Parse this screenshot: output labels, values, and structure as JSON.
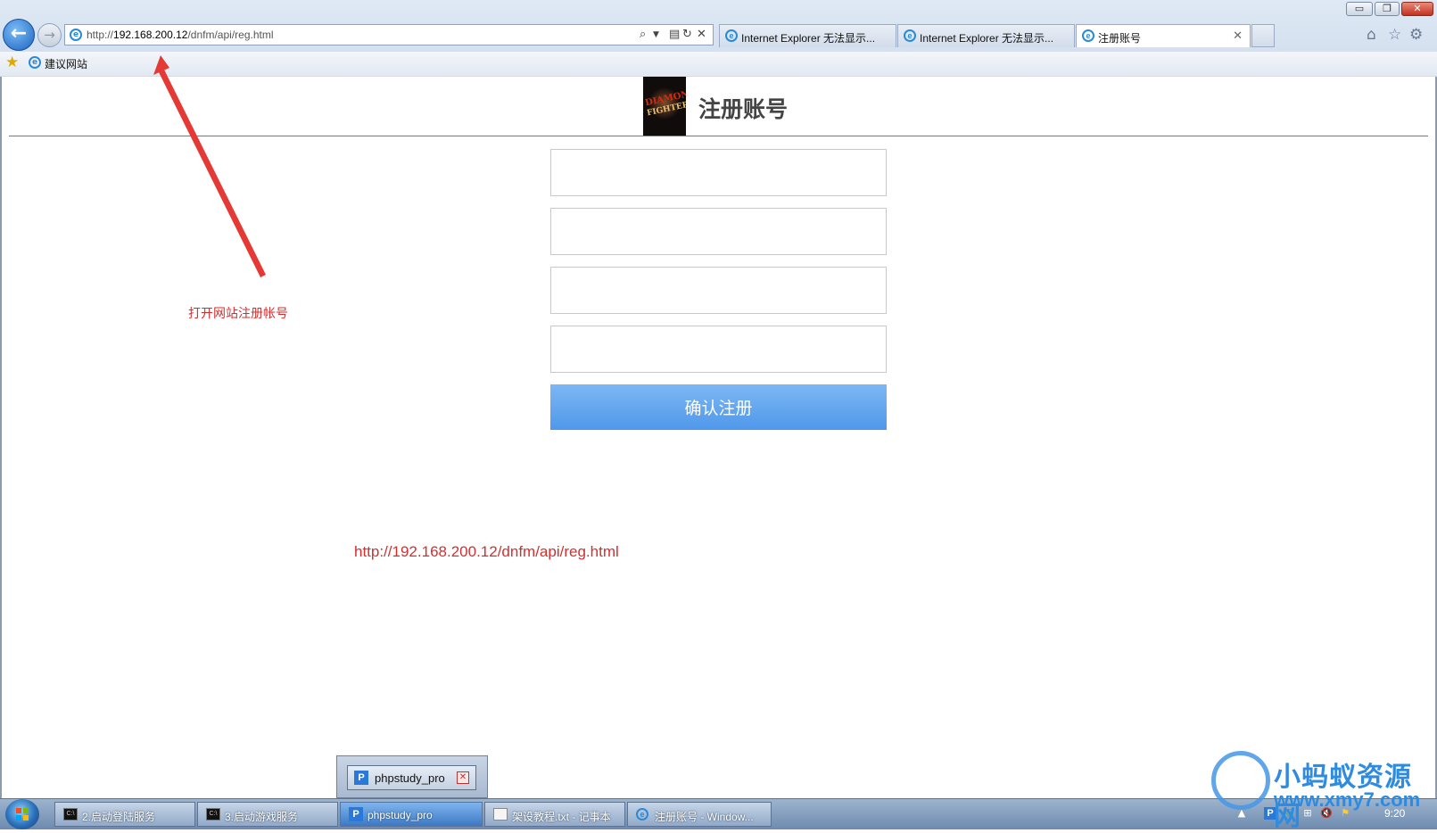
{
  "browser": {
    "window_buttons": {
      "minimize": "▭",
      "restore": "❐",
      "close": "✕"
    },
    "address": {
      "prefix": "http://",
      "host": "192.168.200.12",
      "path": "/dnfm/api/reg.html"
    },
    "tabs": [
      {
        "label": "Internet Explorer 无法显示...",
        "active": false
      },
      {
        "label": "Internet Explorer 无法显示...",
        "active": false
      },
      {
        "label": "注册账号",
        "active": true
      }
    ],
    "favorites": {
      "label": "建议网站"
    }
  },
  "page": {
    "title": "注册账号",
    "logo": {
      "text1": "DIAMOND",
      "text2": "FIGHTER"
    },
    "fields": [
      {
        "placeholder": ""
      },
      {
        "placeholder": ""
      },
      {
        "placeholder": ""
      },
      {
        "placeholder": ""
      }
    ],
    "submit_label": "确认注册"
  },
  "annotations": {
    "note": "打开网站注册帐号",
    "url": "http://192.168.200.12/dnfm/api/reg.html",
    "color": "#d32f2f"
  },
  "taskbar": {
    "thumbnail_popup": {
      "label": "phpstudy_pro"
    },
    "tasks": [
      {
        "label": "2.启动登陆服务",
        "icon": "cmd-icon",
        "active": false
      },
      {
        "label": "3.启动游戏服务",
        "icon": "cmd-icon",
        "active": false
      },
      {
        "label": "phpstudy_pro",
        "icon": "phpstudy-icon",
        "active": true
      },
      {
        "label": "架设教程.txt - 记事本",
        "icon": "notepad-icon",
        "active": false
      },
      {
        "label": "注册账号 - Window...",
        "icon": "ie-icon",
        "active": false
      }
    ],
    "clock": "9:20"
  },
  "watermark": {
    "text1": "小蚂蚁资源网",
    "text2": "www.xmy7.com"
  }
}
